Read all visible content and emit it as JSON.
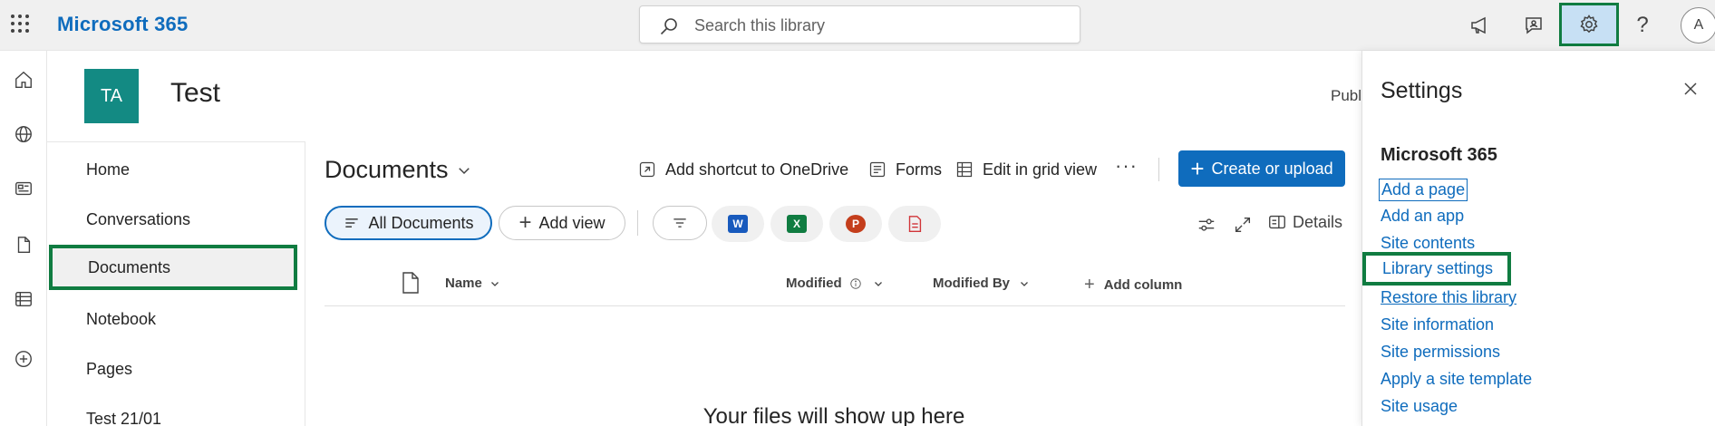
{
  "topbar": {
    "brand": "Microsoft 365",
    "search_placeholder": "Search this library",
    "avatar_initial": "A",
    "help_glyph": "?"
  },
  "site": {
    "logo_initials": "TA",
    "title": "Test",
    "visibility_partial": "Publ"
  },
  "sitenav": {
    "items": [
      {
        "label": "Home"
      },
      {
        "label": "Conversations"
      },
      {
        "label": "Documents"
      },
      {
        "label": "Notebook"
      },
      {
        "label": "Pages"
      },
      {
        "label": "Test 21/01"
      }
    ],
    "selected": "Documents"
  },
  "library": {
    "title": "Documents",
    "commands": {
      "add_shortcut": "Add shortcut to OneDrive",
      "forms": "Forms",
      "edit_grid": "Edit in grid view",
      "more": "···",
      "create": "Create or upload"
    },
    "views": {
      "all_documents": "All Documents",
      "add_view": "Add view"
    },
    "app_filters": [
      {
        "name": "Word",
        "letter": "W",
        "color": "#185abd"
      },
      {
        "name": "Excel",
        "letter": "X",
        "color": "#107c41"
      },
      {
        "name": "PowerPoint",
        "letter": "P",
        "color": "#c43e1c"
      },
      {
        "name": "PDF",
        "letter": "",
        "color": "#d13438"
      }
    ],
    "details_label": "Details",
    "columns": {
      "name": "Name",
      "modified": "Modified",
      "modified_by": "Modified By",
      "add_column": "Add column"
    },
    "empty_message": "Your files will show up here"
  },
  "settings_panel": {
    "title": "Settings",
    "section": "Microsoft 365",
    "links": [
      {
        "label": "Add a page"
      },
      {
        "label": "Add an app"
      },
      {
        "label": "Site contents"
      },
      {
        "label": "Library settings"
      },
      {
        "label": "Restore this library"
      },
      {
        "label": "Site information"
      },
      {
        "label": "Site permissions"
      },
      {
        "label": "Apply a site template"
      },
      {
        "label": "Site usage"
      }
    ]
  },
  "colors": {
    "accent": "#0f6cbd",
    "highlight_border": "#107c41",
    "site_logo": "#138a83",
    "settings_button_bg": "#c7e0f4"
  }
}
